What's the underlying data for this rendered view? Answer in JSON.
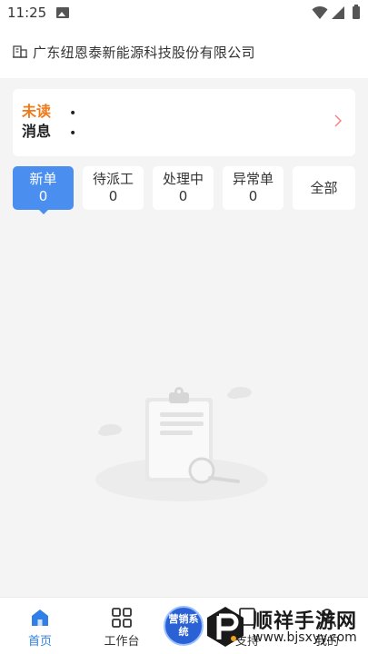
{
  "status_bar": {
    "time": "11:25"
  },
  "header": {
    "company_name": "广东纽恩泰新能源科技股份有限公司"
  },
  "notice": {
    "unread_label": "未读",
    "message_label": "消息",
    "bullets": [
      "•",
      "•"
    ]
  },
  "tabs": [
    {
      "label": "新单",
      "count": "0",
      "active": true
    },
    {
      "label": "待派工",
      "count": "0",
      "active": false
    },
    {
      "label": "处理中",
      "count": "0",
      "active": false
    },
    {
      "label": "异常单",
      "count": "0",
      "active": false
    },
    {
      "label": "全部",
      "count": "",
      "active": false
    }
  ],
  "bottom_nav": {
    "items": [
      {
        "label": "首页",
        "icon": "home-icon",
        "active": true
      },
      {
        "label": "工作台",
        "icon": "grid-icon",
        "active": false
      },
      {
        "label": "支持",
        "icon": "support-icon",
        "active": false
      },
      {
        "label": "我的",
        "icon": "profile-icon",
        "active": false
      }
    ],
    "marketing_badge": "营销系统"
  },
  "watermark": {
    "title": "顺祥手游网",
    "url": "www.bjsxyy.com"
  },
  "colors": {
    "accent": "#4a8ef0",
    "unread_orange": "#f07a1a",
    "nav_active": "#2f7fe6",
    "badge_blue": "#2a62d6"
  }
}
